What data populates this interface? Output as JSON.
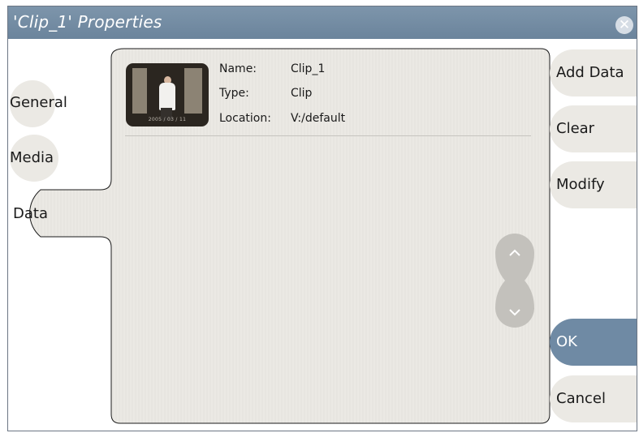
{
  "window": {
    "title": "'Clip_1' Properties"
  },
  "tabs": [
    {
      "label": "General"
    },
    {
      "label": "Media"
    },
    {
      "label": "Data",
      "selected": true
    }
  ],
  "clip": {
    "thumbnail_caption": "2005 / 03 / 11",
    "name_label": "Name:",
    "name_value": "Clip_1",
    "type_label": "Type:",
    "type_value": "Clip",
    "location_label": "Location:",
    "location_value": "V:/default"
  },
  "scroll": {
    "up_icon": "chevron-up-icon",
    "down_icon": "chevron-down-icon"
  },
  "buttons": {
    "add_data": "Add Data",
    "clear": "Clear",
    "modify": "Modify",
    "ok": "OK",
    "cancel": "Cancel"
  },
  "colors": {
    "titlebar": "#6b849c",
    "panel": "#ebe9e4",
    "ok_button": "#6f8aa4"
  }
}
